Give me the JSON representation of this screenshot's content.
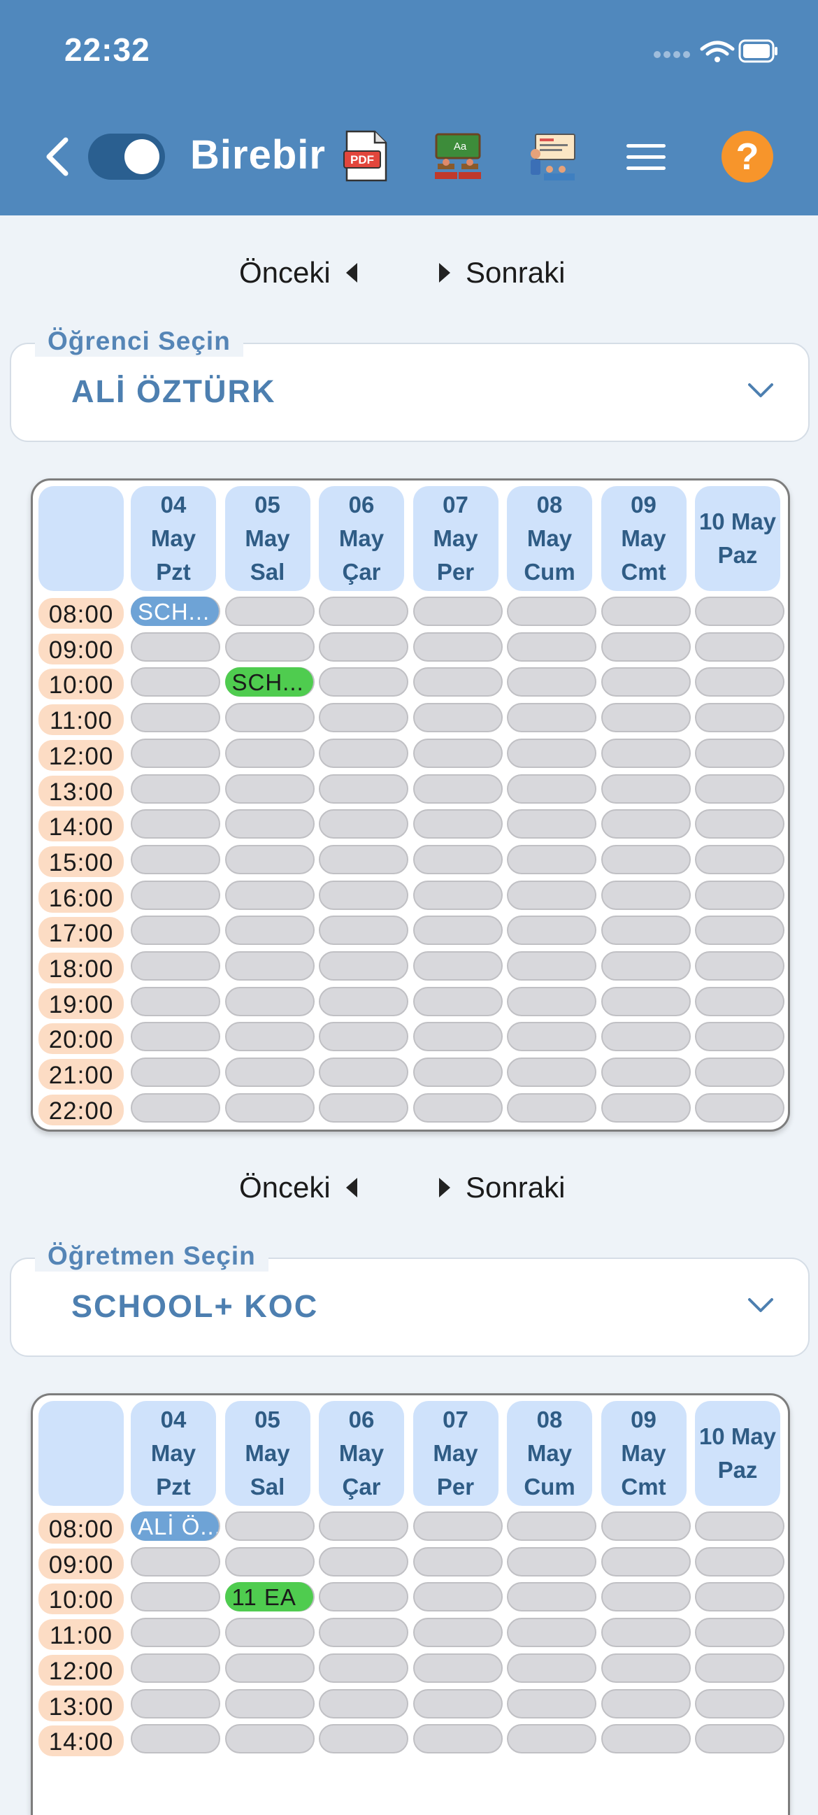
{
  "status": {
    "time": "22:32"
  },
  "toolbar": {
    "title": "Birebir",
    "help": "?"
  },
  "pager": {
    "prev": "Önceki",
    "next": "Sonraki"
  },
  "student_select": {
    "label": "Öğrenci Seçin",
    "value": "ALİ ÖZTÜRK"
  },
  "teacher_select": {
    "label": "Öğretmen Seçin",
    "value": "SCHOOL+ KOC"
  },
  "days": [
    {
      "day": "04",
      "month": "May",
      "weekday": "Pzt"
    },
    {
      "day": "05",
      "month": "May",
      "weekday": "Sal"
    },
    {
      "day": "06",
      "month": "May",
      "weekday": "Çar"
    },
    {
      "day": "07",
      "month": "May",
      "weekday": "Per"
    },
    {
      "day": "08",
      "month": "May",
      "weekday": "Cum"
    },
    {
      "day": "09",
      "month": "May",
      "weekday": "Cmt"
    },
    {
      "day": "10",
      "month": "May",
      "weekday": "Paz"
    }
  ],
  "times_full": [
    "08:00",
    "09:00",
    "10:00",
    "11:00",
    "12:00",
    "13:00",
    "14:00",
    "15:00",
    "16:00",
    "17:00",
    "18:00",
    "19:00",
    "20:00",
    "21:00",
    "22:00"
  ],
  "times_partial": [
    "08:00",
    "09:00",
    "10:00",
    "11:00",
    "12:00",
    "13:00",
    "14:00"
  ],
  "student_events": [
    {
      "day_index": 0,
      "time_index": 0,
      "text": "SCH...",
      "color": "blue"
    },
    {
      "day_index": 1,
      "time_index": 2,
      "text": "SCH...",
      "color": "green"
    }
  ],
  "teacher_events": [
    {
      "day_index": 0,
      "time_index": 0,
      "text": "ALİ Ö...",
      "color": "blue"
    },
    {
      "day_index": 1,
      "time_index": 2,
      "text": "11 EA",
      "color": "green"
    }
  ]
}
